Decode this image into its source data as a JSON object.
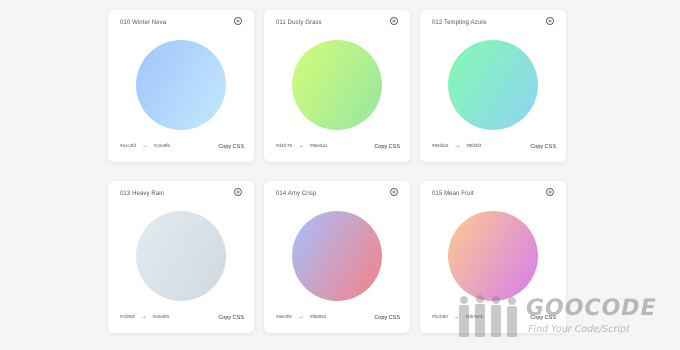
{
  "cards": [
    {
      "title": "010 Winter Neva",
      "from": "#a1c4fd",
      "to": "#c2e9fb",
      "grad_from": "#a1c4fd",
      "grad_to": "#c2e9fb",
      "copy_label": "Copy CSS"
    },
    {
      "title": "011 Dusty Grass",
      "from": "#d4fc79",
      "to": "#96e6a1",
      "grad_from": "#d4fc79",
      "grad_to": "#96e6a1",
      "copy_label": "Copy CSS"
    },
    {
      "title": "012 Tempting Azure",
      "from": "#84fab0",
      "to": "#8fd3f4",
      "grad_from": "#84fab0",
      "grad_to": "#8fd3f4",
      "copy_label": "Copy CSS"
    },
    {
      "title": "013 Heavy Rain",
      "from": "#cfd9df",
      "to": "#e2ebf0",
      "grad_from": "#e2ebf0",
      "grad_to": "#cfd9df",
      "copy_label": "Copy CSS"
    },
    {
      "title": "014 Amy Crisp",
      "from": "#a6c0fe",
      "to": "#f68084",
      "grad_from": "#a6c0fe",
      "grad_to": "#f68084",
      "copy_label": "Copy CSS"
    },
    {
      "title": "015 Mean Fruit",
      "from": "#fccb90",
      "to": "#d57eeb",
      "grad_from": "#fccb90",
      "grad_to": "#d57eeb",
      "copy_label": "Copy CSS"
    }
  ],
  "watermark": {
    "title": "GOOCODE",
    "subtitle": "Find Your Code/Script"
  }
}
